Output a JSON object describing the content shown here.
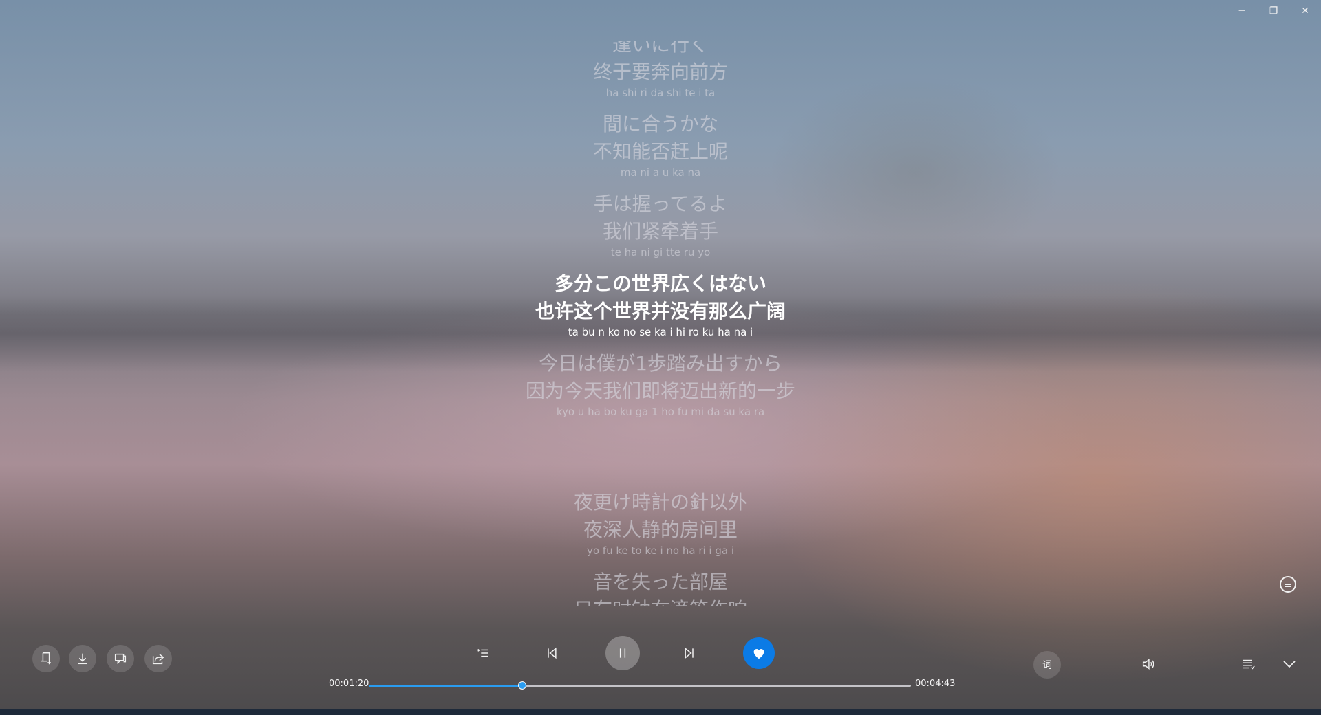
{
  "window": {
    "minimize_glyph": "─",
    "restore_glyph": "❐",
    "close_glyph": "✕"
  },
  "lyrics": {
    "lines": [
      {
        "orig": "逢いに行く",
        "trans": "终于要奔向前方",
        "roma": "ha shi ri da shi te i ta"
      },
      {
        "orig": "間に合うかな",
        "trans": "不知能否赶上呢",
        "roma": "ma ni a u ka na"
      },
      {
        "orig": "手は握ってるよ",
        "trans": "我们紧牵着手",
        "roma": "te ha ni gi tte ru yo"
      },
      {
        "orig": "多分この世界広くはない",
        "trans": "也许这个世界并没有那么广阔",
        "roma": "ta bu n ko no se ka i hi ro ku ha na i",
        "active": true
      },
      {
        "orig": "今日は僕が1歩踏み出すから",
        "trans": "因为今天我们即将迈出新的一步",
        "roma": "kyo u ha bo ku ga 1 ho fu mi da su ka ra"
      },
      {
        "orig": "夜更け時計の針以外",
        "trans": "夜深人静的房间里",
        "roma": "yo fu ke to ke i no ha ri i ga i"
      },
      {
        "orig": "音を失った部屋",
        "trans": "只有时钟在滴答作响",
        "roma": ""
      }
    ]
  },
  "player": {
    "elapsed": "00:01:20",
    "duration": "00:04:43",
    "progress_fraction": 0.2827,
    "lyric_toggle_label": "词",
    "accent_color": "#0b7be6"
  },
  "icons": {
    "left": [
      "add-to-playlist-icon",
      "download-icon",
      "comment-icon",
      "share-icon"
    ],
    "center": [
      "playlist-order-icon",
      "previous-icon",
      "pause-icon",
      "next-icon",
      "heart-icon"
    ],
    "right": [
      "volume-icon",
      "queue-icon",
      "collapse-icon",
      "lyric-mode-icon"
    ]
  }
}
